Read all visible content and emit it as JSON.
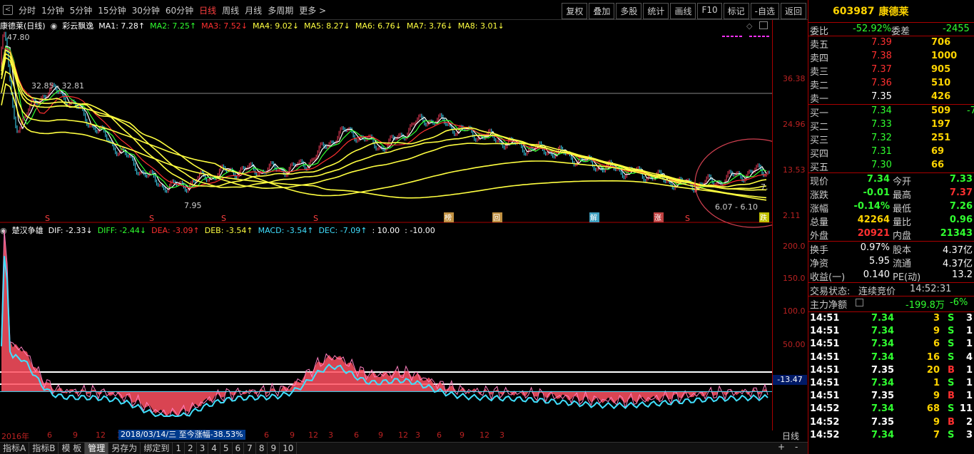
{
  "topbar": {
    "periods": [
      "分时",
      "1分钟",
      "5分钟",
      "15分钟",
      "30分钟",
      "60分钟",
      "日线",
      "周线",
      "月线",
      "多周期",
      "更多 >"
    ],
    "active_period": "日线",
    "tools": [
      "复权",
      "叠加",
      "多股",
      "统计",
      "画线",
      "F10",
      "标记",
      "-自选",
      "返回"
    ]
  },
  "legend_main": {
    "title": "康德莱(日线)",
    "indicator": "彩云飘逸",
    "items": [
      {
        "label": "MA1: 7.28↑",
        "color": "#ffffff"
      },
      {
        "label": "MA2: 7.25↑",
        "color": "#30ff30"
      },
      {
        "label": "MA3: 7.52↓",
        "color": "#ff3030"
      },
      {
        "label": "MA4: 9.02↓",
        "color": "#ffff40"
      },
      {
        "label": "MA5: 8.27↓",
        "color": "#ffff40"
      },
      {
        "label": "MA6: 6.76↓",
        "color": "#ffff40"
      },
      {
        "label": "MA7: 3.76↓",
        "color": "#ffff40"
      },
      {
        "label": "MA8: 3.01↓",
        "color": "#ffff40"
      }
    ]
  },
  "main_chart": {
    "y_ticks": [
      "36.38",
      "24.96",
      "13.53",
      "2.11"
    ],
    "annotations": {
      "high": "47.80",
      "range": "32.85 - 32.81",
      "low1": "7.95",
      "low2": "6.07 - 6.10",
      "last": "7.",
      "s": "S"
    },
    "markers": [
      "榜",
      "回",
      "解",
      "涨",
      "跌"
    ]
  },
  "legend_sub": {
    "title": "楚汉争雄",
    "items": [
      {
        "label": "DIF: -2.33↓",
        "color": "#ffffff"
      },
      {
        "label": "DIFF: -2.44↓",
        "color": "#30ff30"
      },
      {
        "label": "DEA: -3.09↑",
        "color": "#ff3030"
      },
      {
        "label": "DEB: -3.54↑",
        "color": "#ffff40"
      },
      {
        "label": "MACD: -3.54↑",
        "color": "#40e0ff"
      },
      {
        "label": "DEC: -7.09↑",
        "color": "#40e0ff"
      },
      {
        "label": ": 10.00",
        "color": "#ffffff"
      },
      {
        "label": ": -10.00",
        "color": "#ffffff"
      }
    ]
  },
  "sub_chart": {
    "y_ticks": [
      "200.0",
      "150.0",
      "100.0",
      "50.00"
    ],
    "current": "-13.47"
  },
  "date_axis": {
    "labels": [
      "2016年",
      "6",
      "9",
      "12",
      "3",
      "6",
      "9",
      "12",
      "3",
      "6",
      "9",
      "12",
      "3",
      "6",
      "9",
      "12",
      "3"
    ],
    "tooltip": "2018/03/14/三  至今涨幅-38.53%",
    "period_tag": "日线"
  },
  "bottombar": [
    "指标A",
    "指标B",
    "模 板",
    "管理",
    "另存为",
    "绑定到",
    "1",
    "2",
    "3",
    "4",
    "5",
    "6",
    "7",
    "8",
    "9",
    "10"
  ],
  "bottombar_selected": "管理",
  "bottombar_right": [
    "+",
    "-"
  ],
  "panel": {
    "code": "603987",
    "name": "康德莱",
    "weibi": {
      "label": "委比",
      "value": "-52.92%",
      "label2": "委差",
      "value2": "-2455"
    },
    "asks": [
      {
        "label": "卖五",
        "price": "7.39",
        "vol": "706"
      },
      {
        "label": "卖四",
        "price": "7.38",
        "vol": "1000"
      },
      {
        "label": "卖三",
        "price": "7.37",
        "vol": "905"
      },
      {
        "label": "卖二",
        "price": "7.36",
        "vol": "510"
      },
      {
        "label": "卖一",
        "price": "7.35",
        "vol": "426"
      }
    ],
    "bids": [
      {
        "label": "买一",
        "price": "7.34",
        "vol": "509",
        "extra": "-7"
      },
      {
        "label": "买二",
        "price": "7.33",
        "vol": "197",
        "extra": ""
      },
      {
        "label": "买三",
        "price": "7.32",
        "vol": "251",
        "extra": ""
      },
      {
        "label": "买四",
        "price": "7.31",
        "vol": "69",
        "extra": ""
      },
      {
        "label": "买五",
        "price": "7.30",
        "vol": "66",
        "extra": ""
      }
    ],
    "stats": [
      {
        "l1": "现价",
        "v1": "7.34",
        "c1": "green",
        "l2": "今开",
        "v2": "7.33",
        "c2": "green"
      },
      {
        "l1": "涨跌",
        "v1": "-0.01",
        "c1": "green",
        "l2": "最高",
        "v2": "7.37",
        "c2": "red"
      },
      {
        "l1": "涨幅",
        "v1": "-0.14%",
        "c1": "green",
        "l2": "最低",
        "v2": "7.26",
        "c2": "green"
      },
      {
        "l1": "总量",
        "v1": "42264",
        "c1": "yellow",
        "l2": "量比",
        "v2": "0.96",
        "c2": "green"
      },
      {
        "l1": "外盘",
        "v1": "20921",
        "c1": "red",
        "l2": "内盘",
        "v2": "21343",
        "c2": "green"
      }
    ],
    "stats2": [
      {
        "l1": "换手",
        "v1": "0.97%",
        "l2": "股本",
        "v2": "4.37亿"
      },
      {
        "l1": "净资",
        "v1": "5.95",
        "l2": "流通",
        "v2": "4.37亿"
      },
      {
        "l1": "收益(一)",
        "v1": "0.140",
        "l2": "PE(动)",
        "v2": "13.2"
      }
    ],
    "trade_state": {
      "label": "交易状态:",
      "value": "连续竞价",
      "time": "14:52:31"
    },
    "main_flow": {
      "label": "主力净额",
      "value": "-199.8万",
      "pct": "-6%"
    },
    "ticks": [
      {
        "t": "14:51",
        "p": "7.34",
        "v": "3",
        "s": "S",
        "n": "3",
        "pc": "green"
      },
      {
        "t": "14:51",
        "p": "7.34",
        "v": "9",
        "s": "S",
        "n": "1",
        "pc": "green"
      },
      {
        "t": "14:51",
        "p": "7.34",
        "v": "6",
        "s": "S",
        "n": "1",
        "pc": "green"
      },
      {
        "t": "14:51",
        "p": "7.34",
        "v": "16",
        "s": "S",
        "n": "4",
        "pc": "green"
      },
      {
        "t": "14:51",
        "p": "7.35",
        "v": "20",
        "s": "B",
        "n": "1",
        "pc": "white"
      },
      {
        "t": "14:51",
        "p": "7.34",
        "v": "1",
        "s": "S",
        "n": "1",
        "pc": "green"
      },
      {
        "t": "14:51",
        "p": "7.35",
        "v": "9",
        "s": "B",
        "n": "1",
        "pc": "white"
      },
      {
        "t": "14:52",
        "p": "7.34",
        "v": "68",
        "s": "S",
        "n": "11",
        "pc": "green"
      },
      {
        "t": "14:52",
        "p": "7.35",
        "v": "9",
        "s": "B",
        "n": "2",
        "pc": "white"
      },
      {
        "t": "14:52",
        "p": "7.34",
        "v": "7",
        "s": "S",
        "n": "3",
        "pc": "green"
      }
    ]
  }
}
